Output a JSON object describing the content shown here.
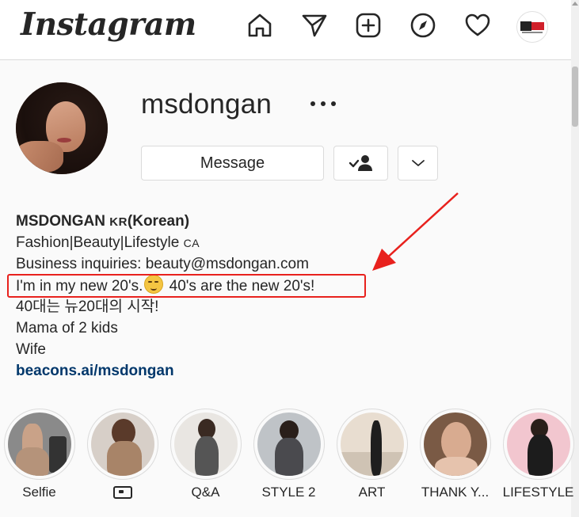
{
  "nav": {
    "logo": "Instagram",
    "icons": [
      "home-icon",
      "direct-message-icon",
      "new-post-icon",
      "explore-icon",
      "activity-heart-icon",
      "profile-avatar"
    ]
  },
  "profile": {
    "username": "msdongan",
    "buttons": {
      "message": "Message"
    }
  },
  "bio": {
    "name": "MSDONGAN",
    "name_country": "KR",
    "name_suffix": "(Korean)",
    "line2": "Fashion|Beauty|Lifestyle",
    "line2_country": "CA",
    "line3": "Business inquiries: beauty@msdongan.com",
    "line4_a": "I'm in my new 20's.",
    "line4_b": "40's are the new 20's!",
    "line5": "40대는 뉴20대의 시작!",
    "line6": "Mama of 2 kids",
    "line7": "Wife",
    "link": "beacons.ai/msdongan"
  },
  "highlights": [
    {
      "label": "Selfie"
    },
    {
      "label": ""
    },
    {
      "label": "Q&A"
    },
    {
      "label": "STYLE 2"
    },
    {
      "label": "ART"
    },
    {
      "label": "THANK Y..."
    },
    {
      "label": "LIFESTYLE"
    }
  ],
  "colors": {
    "annotation_red": "#e8211d",
    "link_blue": "#00376b",
    "text": "#262626",
    "border": "#dbdbdb"
  }
}
